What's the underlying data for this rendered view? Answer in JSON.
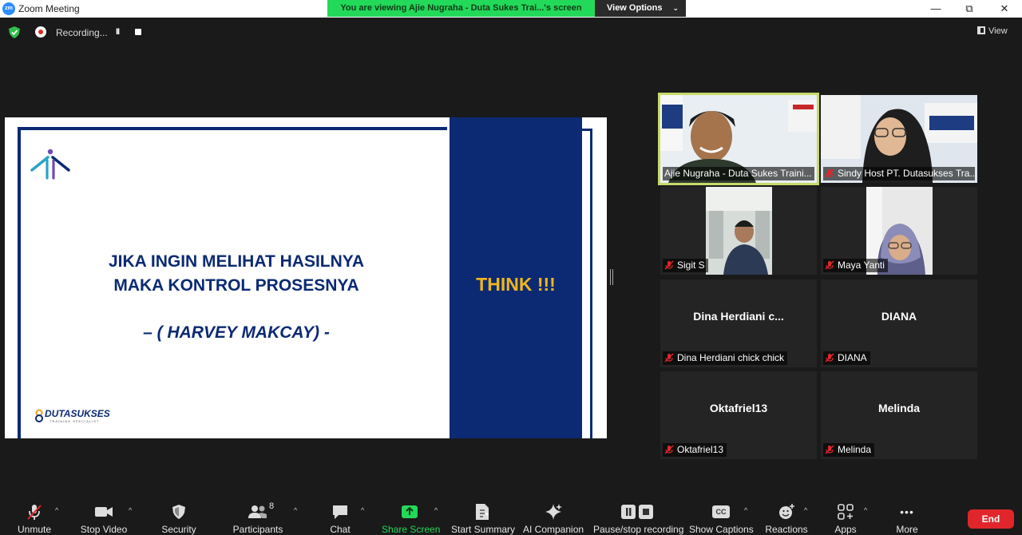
{
  "window": {
    "app_icon_text": "zm",
    "title": "Zoom Meeting",
    "minimize": "—",
    "maximize": "⧉",
    "close": "✕"
  },
  "share_banner": {
    "text": "You are viewing Ajie Nugraha - Duta Sukes Trai...'s screen",
    "options_label": "View Options",
    "options_chevron": "⌄"
  },
  "recording": {
    "label": "Recording...",
    "pause_glyph": "II"
  },
  "view_button": {
    "label": "View"
  },
  "slide": {
    "line1": "JIKA INGIN MELIHAT HASILNYA",
    "line2": "MAKA KONTROL PROSESNYA",
    "author": "– ( HARVEY MAKCAY) -",
    "think": "THINK !!!",
    "brand_name": "DUTASUKSES",
    "brand_tagline": "TRAINING SPECIALIST"
  },
  "participants": [
    {
      "display_name": "",
      "label": "Ajie Nugraha - Duta Sukes Traini...",
      "muted": false,
      "has_video": true,
      "active_speaker": true
    },
    {
      "display_name": "",
      "label": "Sindy Host PT. Dutasukses Tra...",
      "muted": true,
      "has_video": true,
      "active_speaker": false
    },
    {
      "display_name": "",
      "label": "Sigit S",
      "muted": true,
      "has_video": true,
      "active_speaker": false
    },
    {
      "display_name": "",
      "label": "Maya Yanti",
      "muted": true,
      "has_video": true,
      "active_speaker": false
    },
    {
      "display_name": "Dina  Herdiani  c...",
      "label": "Dina Herdiani chick chick",
      "muted": true,
      "has_video": false,
      "active_speaker": false
    },
    {
      "display_name": "DIANA",
      "label": "DIANA",
      "muted": true,
      "has_video": false,
      "active_speaker": false
    },
    {
      "display_name": "Oktafriel13",
      "label": "Oktafriel13",
      "muted": true,
      "has_video": false,
      "active_speaker": false
    },
    {
      "display_name": "Melinda",
      "label": "Melinda",
      "muted": true,
      "has_video": false,
      "active_speaker": false
    }
  ],
  "toolbar": {
    "unmute": "Unmute",
    "stop_video": "Stop Video",
    "security": "Security",
    "participants": "Participants",
    "participants_count": "8",
    "chat": "Chat",
    "share_screen": "Share Screen",
    "start_summary": "Start Summary",
    "ai_companion": "AI Companion",
    "pause_recording": "Pause/stop recording",
    "show_captions": "Show Captions",
    "captions_glyph": "CC",
    "reactions": "Reactions",
    "apps": "Apps",
    "more": "More",
    "more_glyph": "•••",
    "caret": "^",
    "end": "End"
  },
  "colors": {
    "share_green": "#23d959",
    "slide_navy": "#0b2a73",
    "think_gold": "#f1b51c",
    "active_speaker_border": "#c7d96a",
    "end_red": "#e0262b",
    "mute_red": "#e0262b"
  }
}
